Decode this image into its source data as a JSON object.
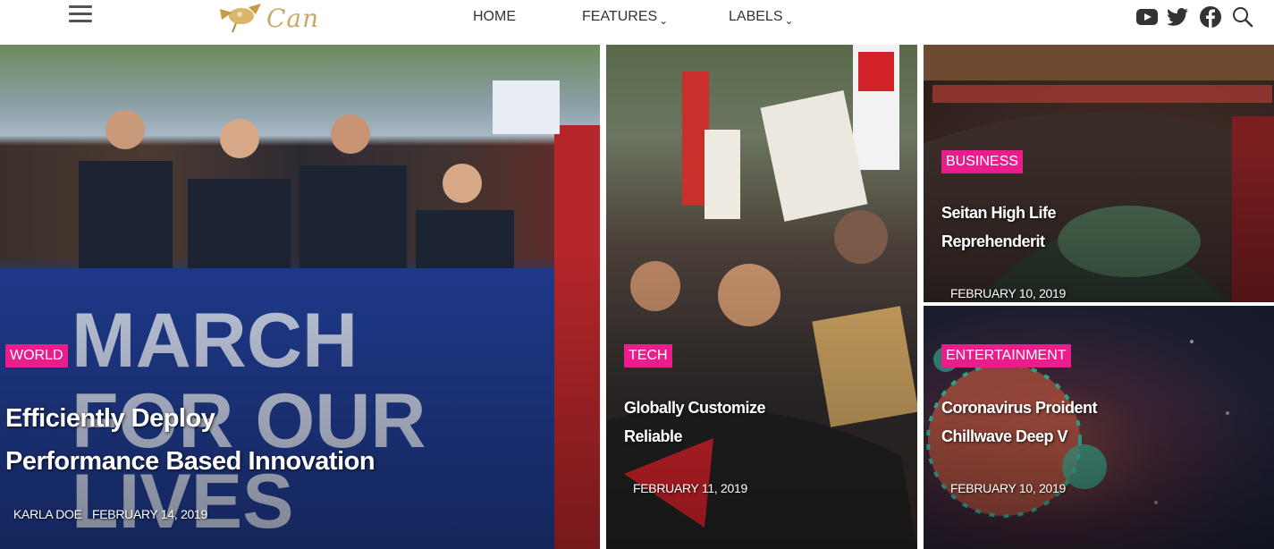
{
  "header": {
    "logo_text": "Can",
    "nav": [
      {
        "label": "HOME",
        "has_dropdown": false
      },
      {
        "label": "FEATURES",
        "has_dropdown": true
      },
      {
        "label": "LABELS",
        "has_dropdown": true
      }
    ],
    "social_icons": [
      "youtube-icon",
      "twitter-icon",
      "facebook-icon",
      "search-icon"
    ]
  },
  "colors": {
    "tag_bg": "#e91e8c",
    "text": "#ffffff",
    "nav_text": "#333333"
  },
  "posts": [
    {
      "tag": "WORLD",
      "title_line1": "Efficiently Deploy",
      "title_line2": "Performance Based Innovation",
      "author": "KARLA DOE",
      "date": "FEBRUARY 14, 2019"
    },
    {
      "tag": "TECH",
      "title_line1": "Globally Customize",
      "title_line2": "Reliable",
      "date": "FEBRUARY 11, 2019"
    },
    {
      "tag": "BUSINESS",
      "title_line1": "Seitan High Life",
      "title_line2": "Reprehenderit",
      "date": "FEBRUARY 10, 2019"
    },
    {
      "tag": "ENTERTAINMENT",
      "title_line1": "Coronavirus Proident",
      "title_line2": "Chillwave Deep V",
      "date": "FEBRUARY 10, 2019"
    }
  ]
}
